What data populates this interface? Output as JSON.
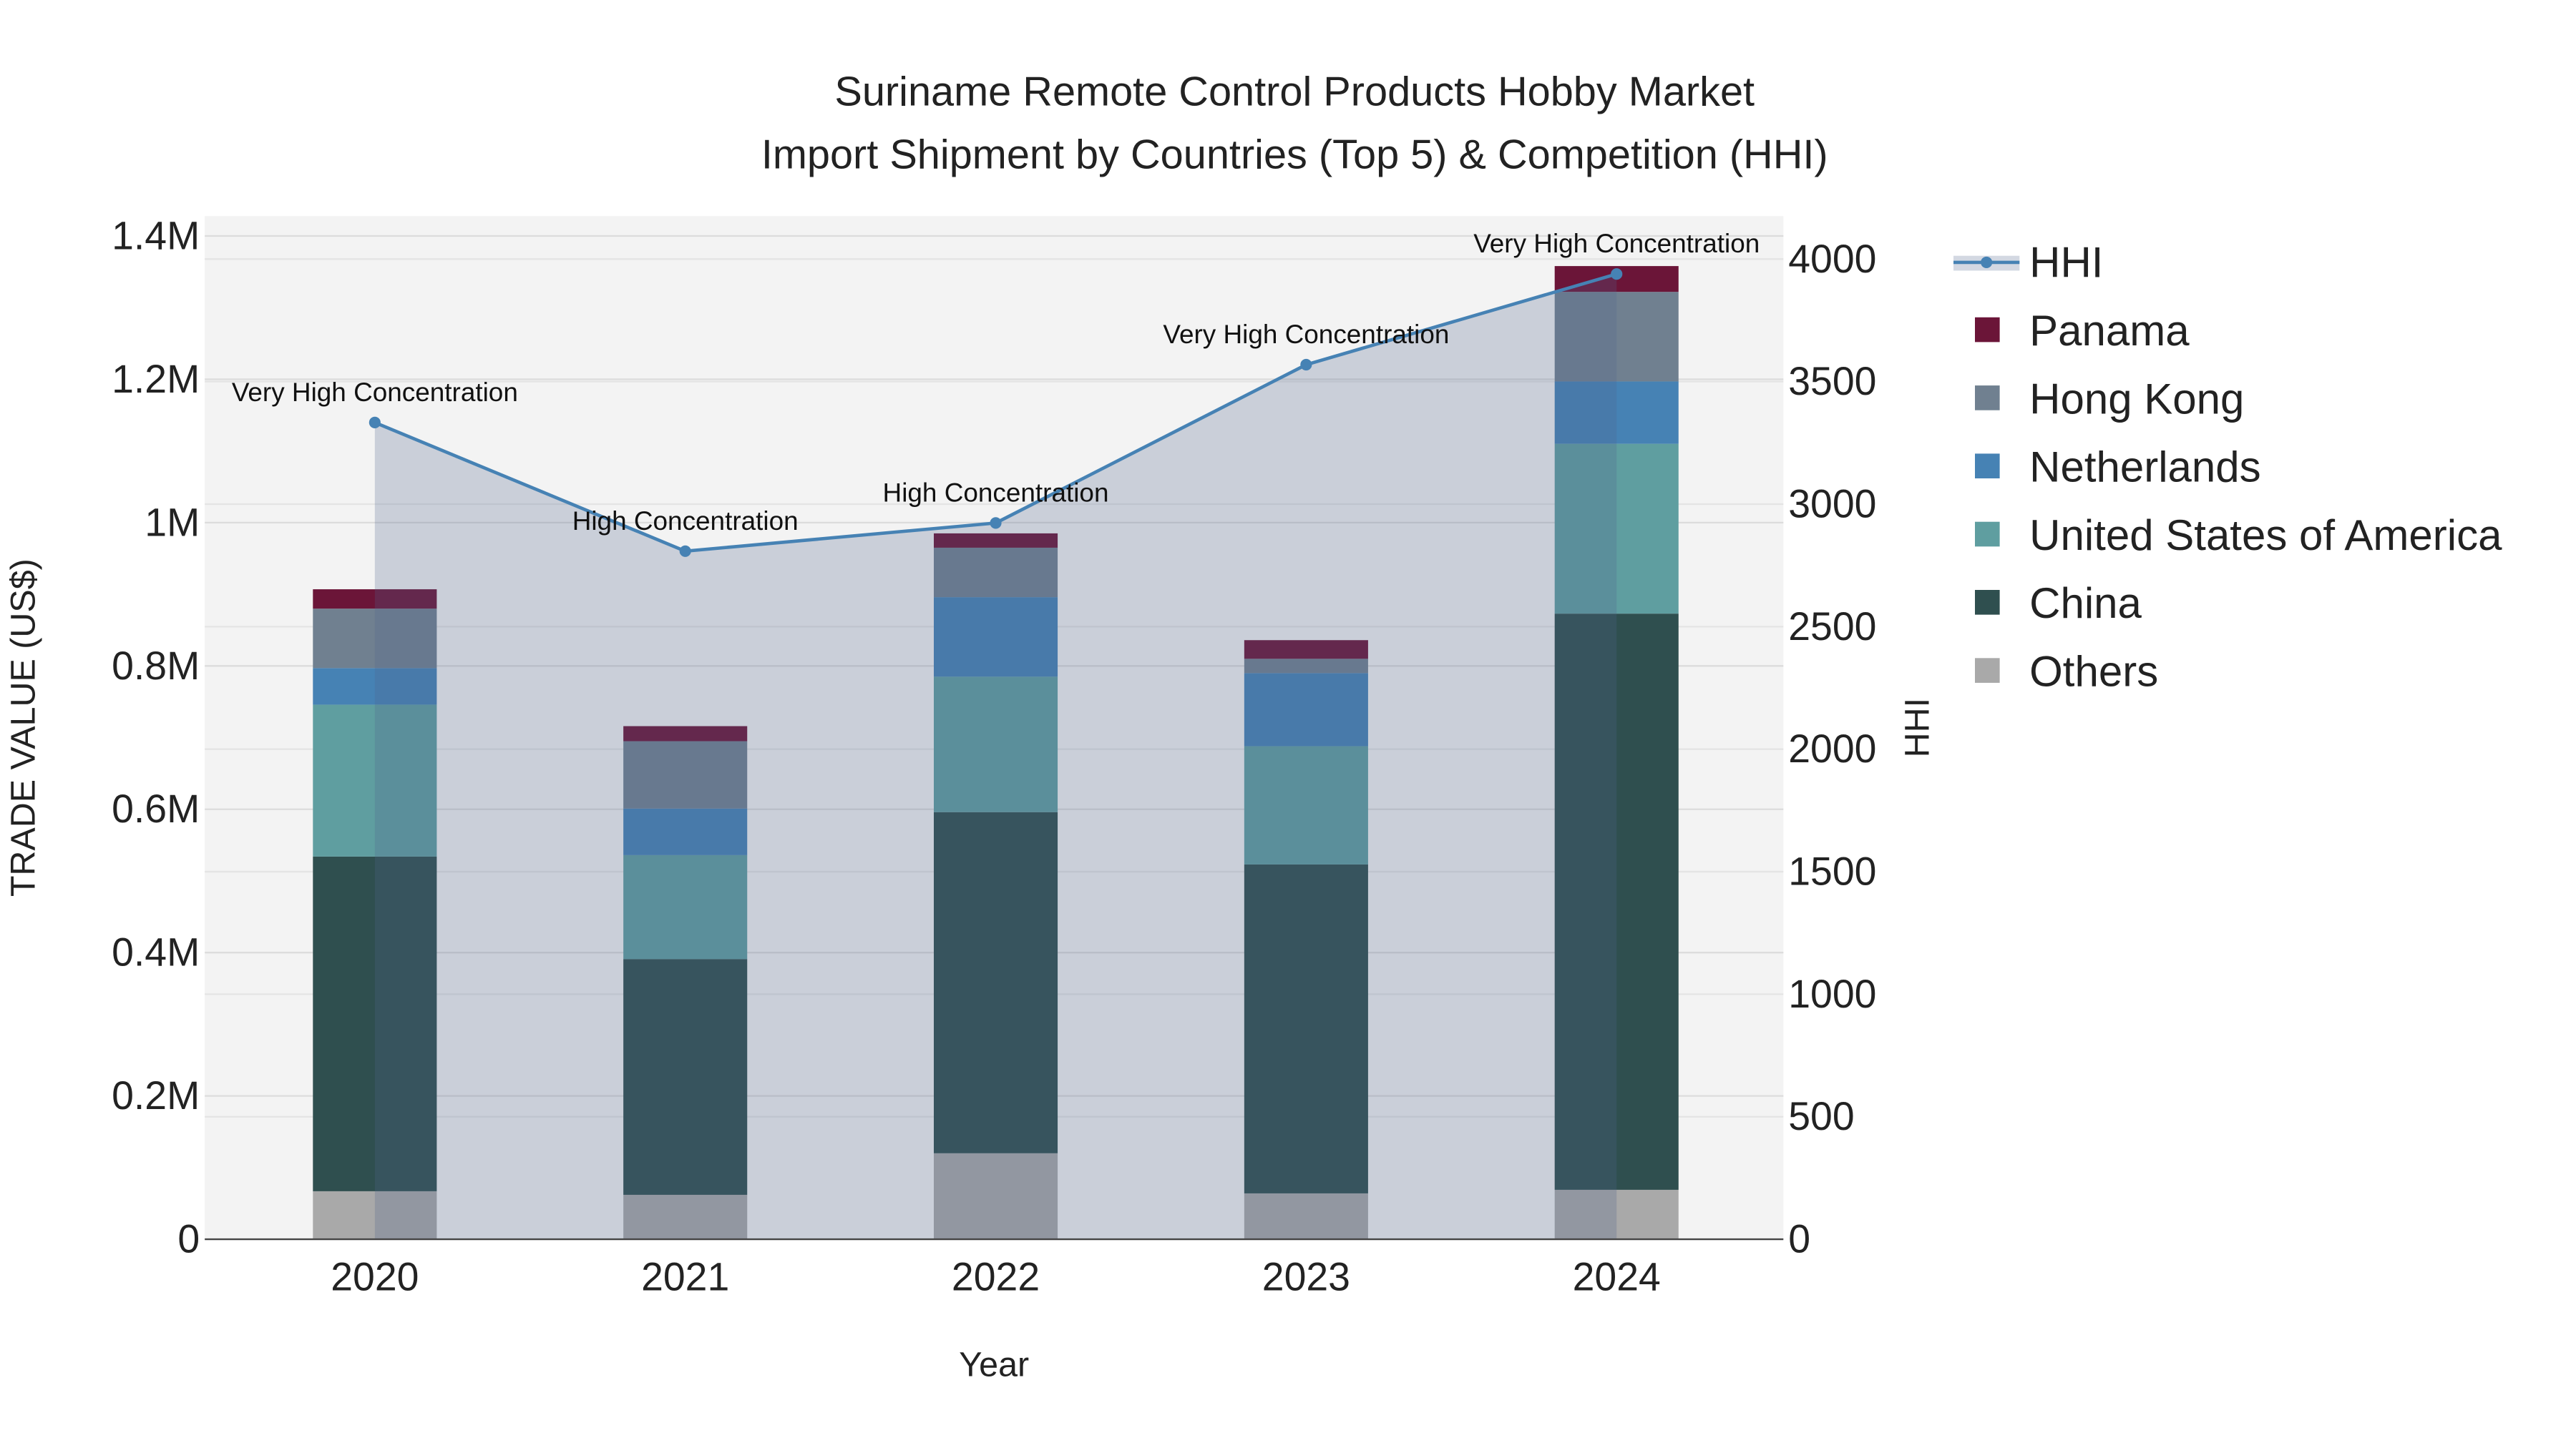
{
  "chart_data": {
    "type": "bar",
    "title_line1": "Suriname Remote Control Products Hobby Market",
    "title_line2": "Import Shipment by Countries (Top 5) & Competition (HHI)",
    "xlabel": "Year",
    "ylabel": "TRADE VALUE (US$)",
    "y2label": "HHI",
    "categories": [
      "2020",
      "2021",
      "2022",
      "2023",
      "2024"
    ],
    "ylim": [
      0,
      1400000
    ],
    "y2lim": [
      0,
      4000
    ],
    "yticks": [
      {
        "value": 0,
        "label": "0"
      },
      {
        "value": 200000,
        "label": "0.2M"
      },
      {
        "value": 400000,
        "label": "0.4M"
      },
      {
        "value": 600000,
        "label": "0.6M"
      },
      {
        "value": 800000,
        "label": "0.8M"
      },
      {
        "value": 1000000,
        "label": "1M"
      },
      {
        "value": 1200000,
        "label": "1.2M"
      },
      {
        "value": 1400000,
        "label": "1.4M"
      }
    ],
    "y2ticks": [
      {
        "value": 0,
        "label": "0"
      },
      {
        "value": 500,
        "label": "500"
      },
      {
        "value": 1000,
        "label": "1000"
      },
      {
        "value": 1500,
        "label": "1500"
      },
      {
        "value": 2000,
        "label": "2000"
      },
      {
        "value": 2500,
        "label": "2500"
      },
      {
        "value": 3000,
        "label": "3000"
      },
      {
        "value": 3500,
        "label": "3500"
      },
      {
        "value": 4000,
        "label": "4000"
      }
    ],
    "series": [
      {
        "name": "Others",
        "color": "#a9a9a9",
        "values": [
          67000,
          62000,
          120000,
          64000,
          69000
        ]
      },
      {
        "name": "China",
        "color": "#2f4f4f",
        "values": [
          467000,
          329000,
          476000,
          459000,
          804000
        ]
      },
      {
        "name": "United States of America",
        "color": "#5f9ea0",
        "values": [
          212000,
          145000,
          189000,
          165000,
          237000
        ]
      },
      {
        "name": "Netherlands",
        "color": "#4682b4",
        "values": [
          51000,
          65000,
          111000,
          102000,
          87000
        ]
      },
      {
        "name": "Hong Kong",
        "color": "#708090",
        "values": [
          83000,
          94000,
          69000,
          20000,
          125000
        ]
      },
      {
        "name": "Panama",
        "color": "#6b1538",
        "values": [
          27000,
          21000,
          20000,
          26000,
          36000
        ]
      }
    ],
    "hhi": {
      "name": "HHI",
      "color": "#4682b4",
      "values": [
        3333,
        2808,
        2923,
        3569,
        3939
      ],
      "annotations": [
        "Very High Concentration",
        "High Concentration",
        "High Concentration",
        "Very High Concentration",
        "Very High Concentration"
      ]
    },
    "legend_order": [
      "HHI",
      "Panama",
      "Hong Kong",
      "Netherlands",
      "United States of America",
      "China",
      "Others"
    ],
    "legend_position": "right",
    "grid": true
  }
}
